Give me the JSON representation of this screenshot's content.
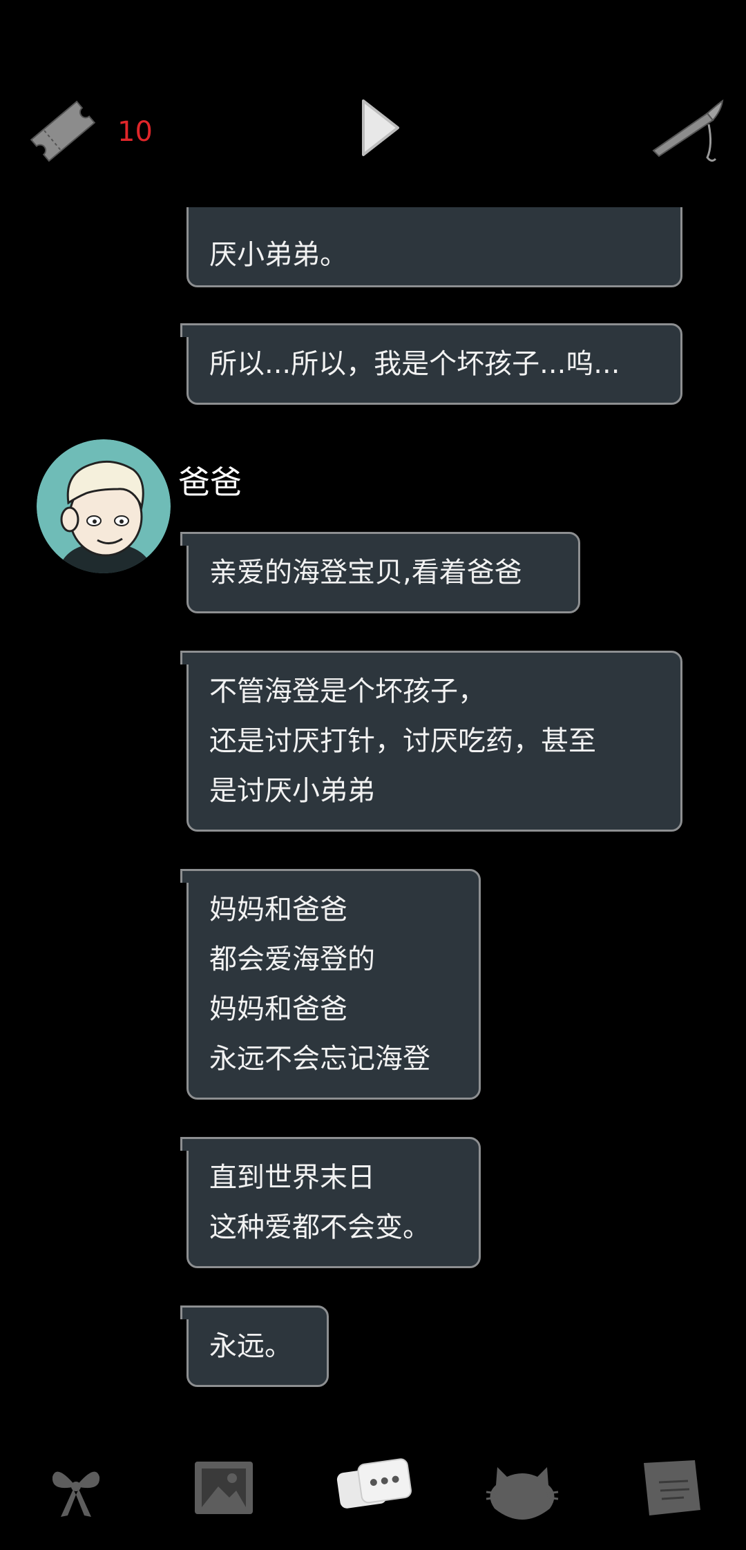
{
  "topbar": {
    "ticket_count": "10"
  },
  "chat": {
    "messages_top": [
      {
        "lines": [
          "厌小弟弟。"
        ]
      },
      {
        "lines": [
          "所以...所以，我是个坏孩子...呜..."
        ]
      }
    ],
    "sender_name": "爸爸",
    "messages_dad": [
      {
        "lines": [
          "亲爱的海登宝贝,看着爸爸"
        ]
      },
      {
        "lines": [
          "不管海登是个坏孩子，",
          "还是讨厌打针，讨厌吃药，甚至",
          "是讨厌小弟弟"
        ]
      },
      {
        "lines": [
          "妈妈和爸爸",
          "都会爱海登的",
          "妈妈和爸爸",
          "永远不会忘记海登"
        ]
      },
      {
        "lines": [
          "直到世界末日",
          "这种爱都不会变。"
        ]
      },
      {
        "lines": [
          "永远。"
        ]
      }
    ]
  },
  "bottom_nav": {
    "tabs": [
      "bow-icon",
      "photo-icon",
      "chat-icon",
      "cat-icon",
      "notes-icon"
    ],
    "active": "chat-icon"
  },
  "colors": {
    "bubble_bg": "#2d363d",
    "bubble_border": "#8d8f91",
    "ticket_count": "#e0262a",
    "avatar_bg": "#6fbcb7"
  }
}
